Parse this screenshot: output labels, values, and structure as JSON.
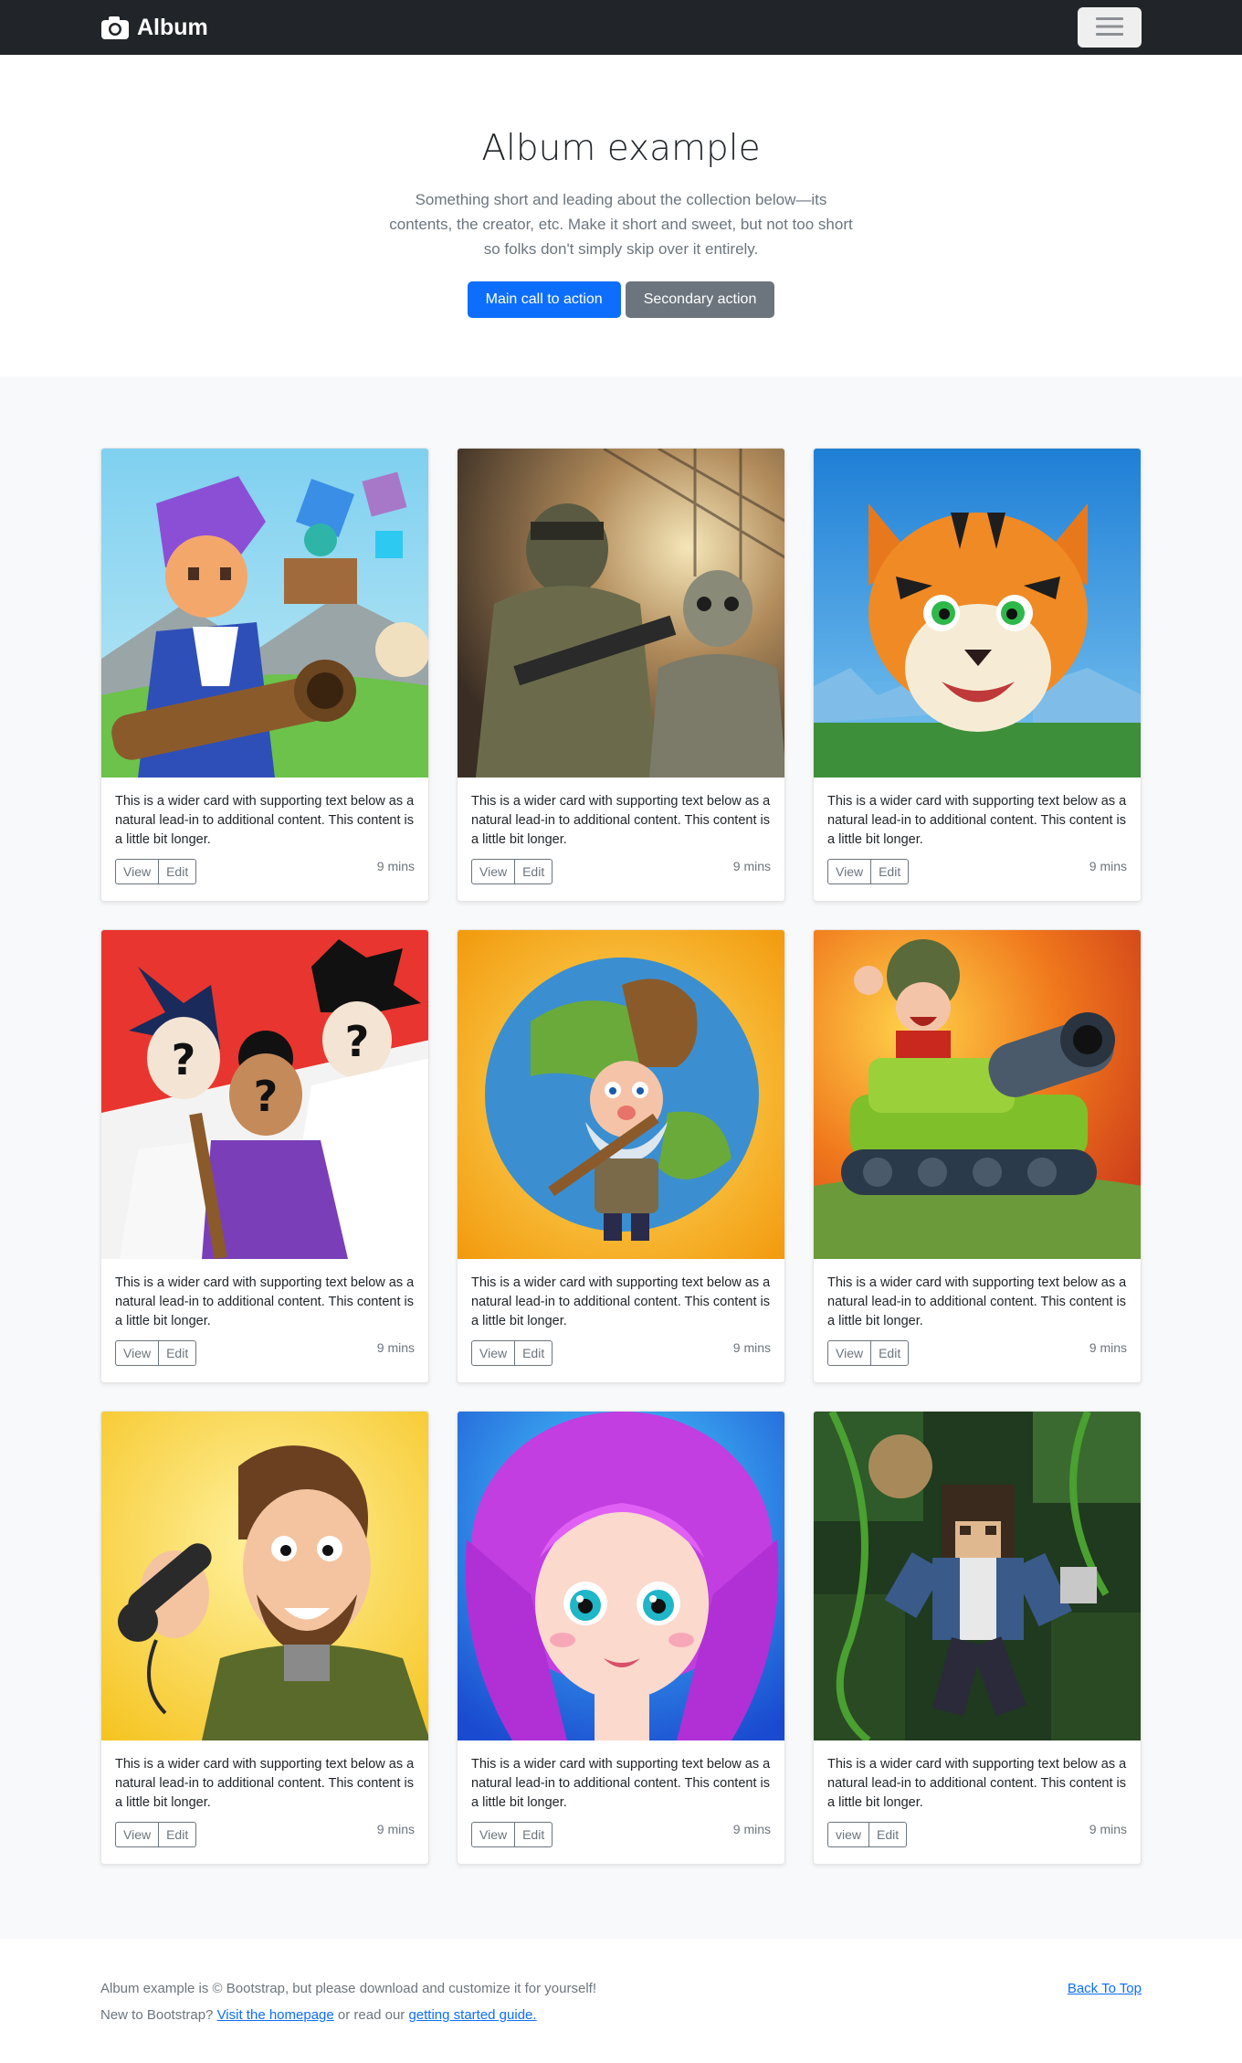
{
  "navbar": {
    "brand": "Album",
    "icons": {
      "camera": "camera-icon",
      "menu": "hamburger-icon"
    }
  },
  "hero": {
    "title": "Album example",
    "lead": "Something short and leading about the collection below—its contents, the creator, etc. Make it short and sweet, but not too short so folks don't simply skip over it entirely.",
    "primary_label": "Main call to action",
    "secondary_label": "Secondary action"
  },
  "cards": [
    {
      "text": "This is a wider card with supporting text below as a natural lead-in to additional content. This content is a little bit longer.",
      "view": "View",
      "edit": "Edit",
      "time": "9 mins",
      "art": "blocky-hero-cannon"
    },
    {
      "text": "This is a wider card with supporting text below as a natural lead-in to additional content. This content is a little bit longer.",
      "view": "View",
      "edit": "Edit",
      "time": "9 mins",
      "art": "soldiers"
    },
    {
      "text": "This is a wider card with supporting text below as a natural lead-in to additional content. This content is a little bit longer.",
      "view": "View",
      "edit": "Edit",
      "time": "9 mins",
      "art": "tiger"
    },
    {
      "text": "This is a wider card with supporting text below as a natural lead-in to additional content. This content is a little bit longer.",
      "view": "View",
      "edit": "Edit",
      "time": "9 mins",
      "art": "anime-quiz"
    },
    {
      "text": "This is a wider card with supporting text below as a natural lead-in to additional content. This content is a little bit longer.",
      "view": "View",
      "edit": "Edit",
      "time": "9 mins",
      "art": "miner-globe"
    },
    {
      "text": "This is a wider card with supporting text below as a natural lead-in to additional content. This content is a little bit longer.",
      "view": "View",
      "edit": "Edit",
      "time": "9 mins",
      "art": "tank"
    },
    {
      "text": "This is a wider card with supporting text below as a natural lead-in to additional content. This content is a little bit longer.",
      "view": "View",
      "edit": "Edit",
      "time": "9 mins",
      "art": "phone-man"
    },
    {
      "text": "This is a wider card with supporting text below as a natural lead-in to additional content. This content is a little bit longer.",
      "view": "View",
      "edit": "Edit",
      "time": "9 mins",
      "art": "doll-girl"
    },
    {
      "text": "This is a wider card with supporting text below as a natural lead-in to additional content. This content is a little bit longer.",
      "view": "view",
      "edit": "Edit",
      "time": "9 mins",
      "art": "blocky-jungle"
    }
  ],
  "footer": {
    "line1": "Album example is © Bootstrap, but please download and customize it for yourself!",
    "line2_prefix": "New to Bootstrap? ",
    "homepage_link": "Visit the homepage",
    "line2_mid": " or read our ",
    "guide_link": "getting started guide.",
    "back_to_top": "Back To Top"
  },
  "colors": {
    "navbar": "#212529",
    "primary": "#0d6efd",
    "secondary": "#6c757d",
    "album_bg": "#f8f9fa"
  }
}
